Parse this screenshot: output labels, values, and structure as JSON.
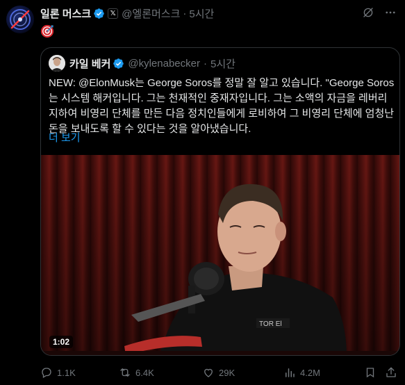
{
  "author": {
    "display_name": "일론 머스크",
    "badge_label": "𝕏",
    "handle": "@엘론머스크",
    "separator": "·",
    "time": "5시간",
    "avatar_icon": "galaxy-avatar"
  },
  "post": {
    "body_icon": "direct-hit-emoji"
  },
  "quoted": {
    "display_name": "카일 베커",
    "handle": "@kylenabecker",
    "separator": "·",
    "time": "5시간",
    "text": "NEW: @ElonMusk는 George Soros를 정말 잘 알고 있습니다. \"George Soros는 시스템 해커입니다. 그는 천재적인 중재자입니다. 그는 소액의 자금을 레버리지하여 비영리 단체를 만든 다음 정치인들에게 로비하여 그 비영리 단체에 엄청난 돈을 보내도록 할 수 있다는 것을 알아냈습니다.",
    "show_more": "더 보기",
    "video_duration": "1:02"
  },
  "actions": {
    "replies": "1.1K",
    "reposts": "6.4K",
    "likes": "29K",
    "views": "4.2M"
  },
  "colors": {
    "accent": "#1d9bf0",
    "muted": "#71767b",
    "text": "#e7e9ea",
    "border": "#2f3336",
    "background": "#000000"
  }
}
